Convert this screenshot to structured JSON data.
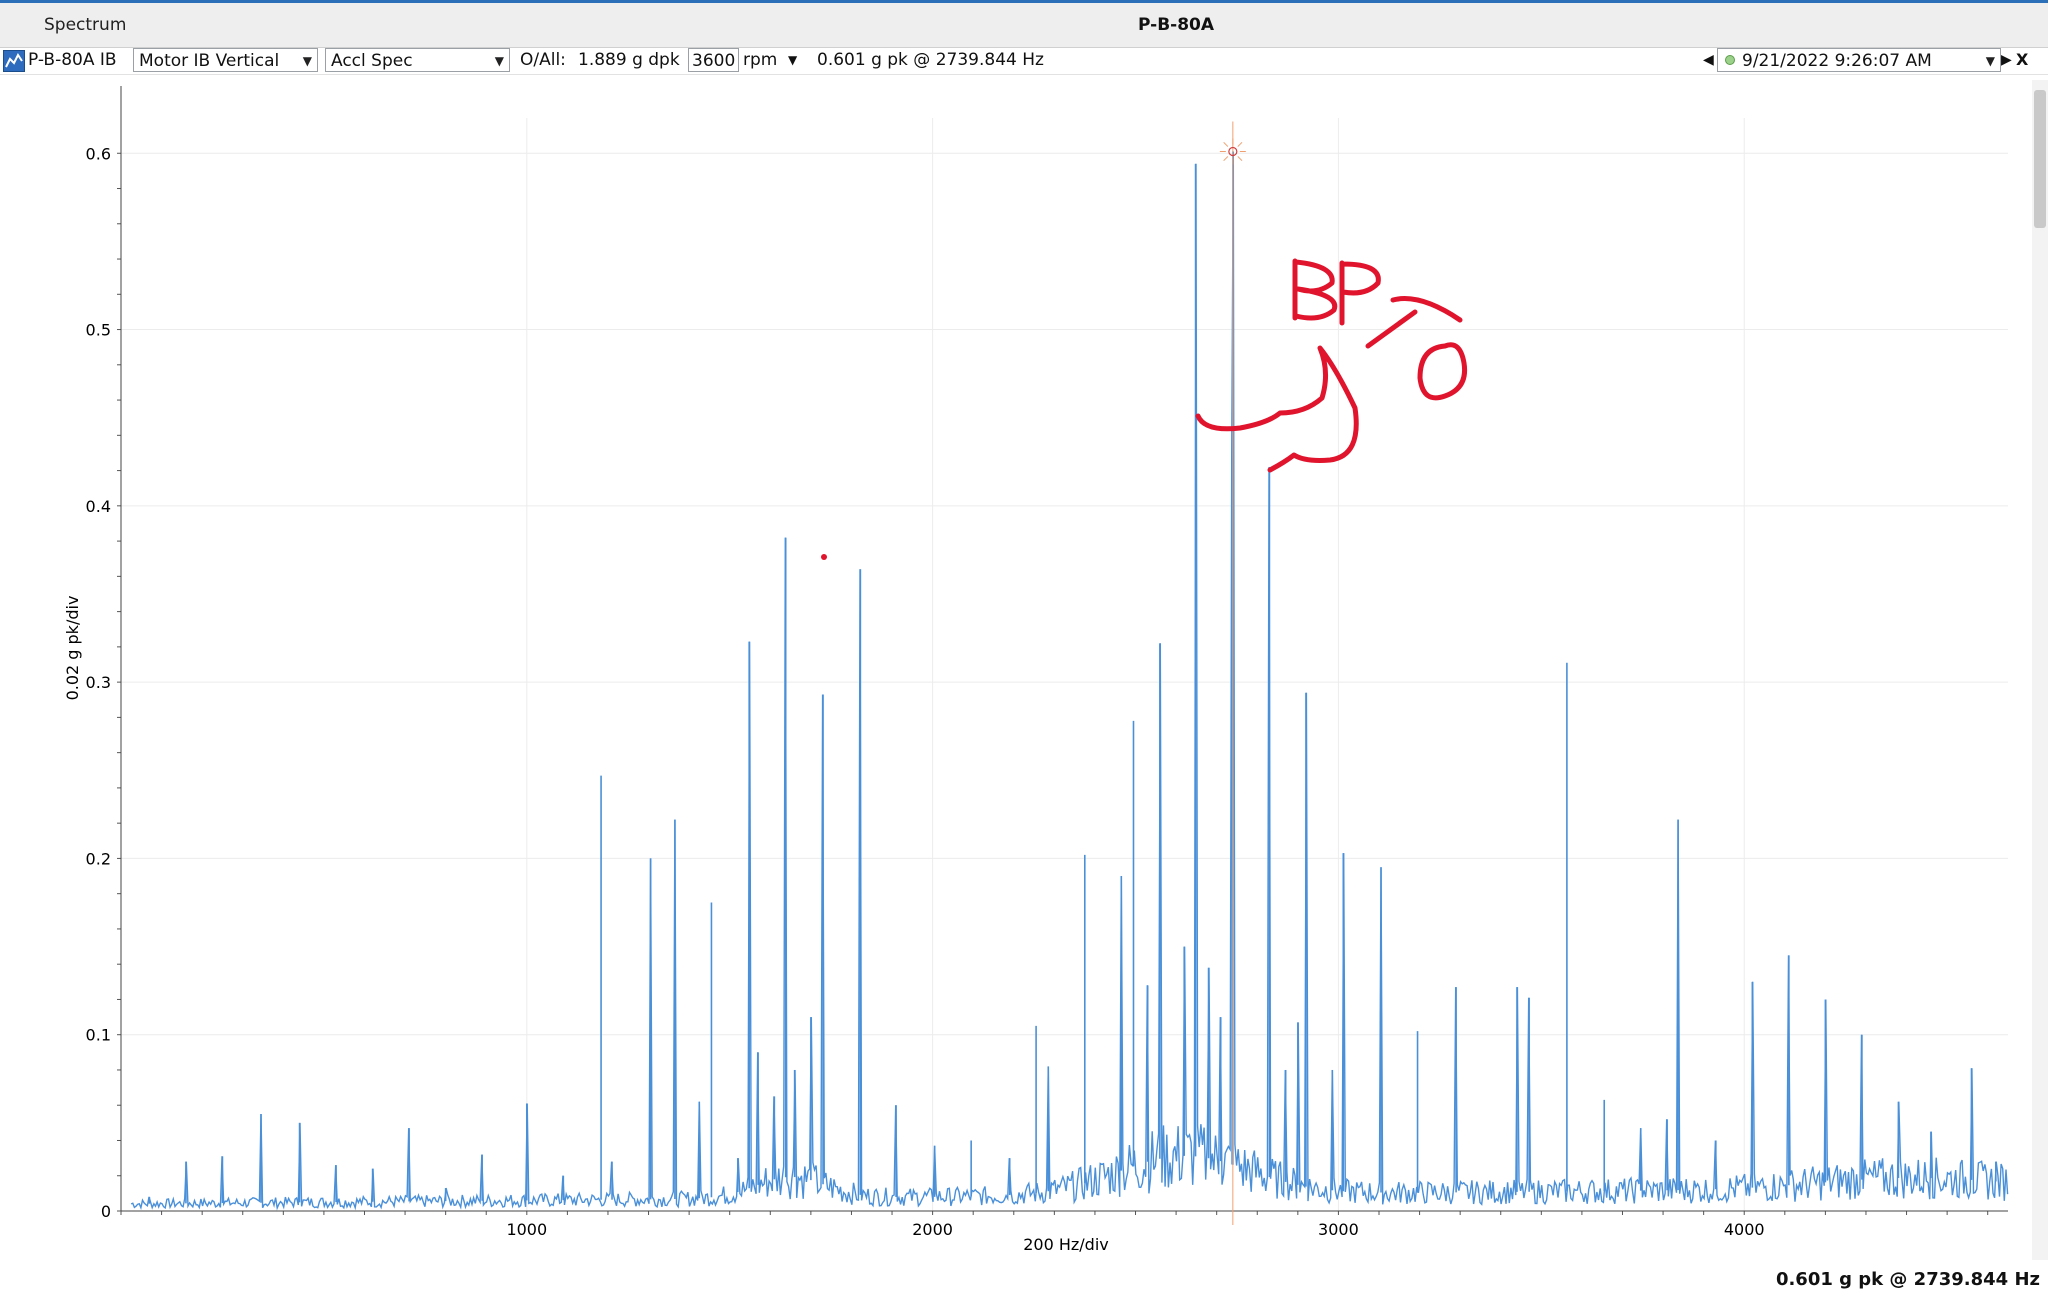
{
  "window": {
    "tab_label": "Spectrum",
    "title": "P-B-80A"
  },
  "toolbar": {
    "point_label": "P-B-80A IB",
    "measurement_select": "Motor IB Vertical",
    "spectrum_type_select": "Accl Spec",
    "overall_label": "O/All:",
    "overall_value": "1.889 g dpk",
    "rpm_value": "3600",
    "rpm_unit": "rpm",
    "cursor_readout": "0.601 g pk  @ 2739.844 Hz",
    "date_select": "9/21/2022 9:26:07 AM",
    "prev_icon": "triangle-left-icon",
    "next_icon": "triangle-right-icon",
    "close_label": "X",
    "status_color": "#9bd18a"
  },
  "annotation": {
    "text": "BPFO",
    "color": "#e0142c"
  },
  "footer": {
    "readout": "0.601 g pk @ 2739.844 Hz"
  },
  "chart_data": {
    "type": "line",
    "xlabel": "200 Hz/div",
    "ylabel": "0.02 g pk/div",
    "xlim": [
      0,
      4650
    ],
    "ylim": [
      0,
      0.62
    ],
    "xticks": [
      1000,
      2000,
      3000,
      4000
    ],
    "yticks": [
      0,
      0.1,
      0.2,
      0.3,
      0.4,
      0.5,
      0.6
    ],
    "grid": true,
    "line_color": "#4a90d9",
    "cursor": {
      "x": 2739.844,
      "y": 0.601
    },
    "peaks": [
      {
        "x": 70,
        "y": 0.008
      },
      {
        "x": 160,
        "y": 0.028
      },
      {
        "x": 250,
        "y": 0.031
      },
      {
        "x": 345,
        "y": 0.055
      },
      {
        "x": 440,
        "y": 0.05
      },
      {
        "x": 530,
        "y": 0.026
      },
      {
        "x": 620,
        "y": 0.024
      },
      {
        "x": 710,
        "y": 0.047
      },
      {
        "x": 800,
        "y": 0.013
      },
      {
        "x": 890,
        "y": 0.032
      },
      {
        "x": 1000,
        "y": 0.061
      },
      {
        "x": 1090,
        "y": 0.02
      },
      {
        "x": 1183,
        "y": 0.247
      },
      {
        "x": 1210,
        "y": 0.028
      },
      {
        "x": 1305,
        "y": 0.2
      },
      {
        "x": 1365,
        "y": 0.222
      },
      {
        "x": 1425,
        "y": 0.062
      },
      {
        "x": 1455,
        "y": 0.175
      },
      {
        "x": 1520,
        "y": 0.03
      },
      {
        "x": 1548,
        "y": 0.323
      },
      {
        "x": 1570,
        "y": 0.09
      },
      {
        "x": 1610,
        "y": 0.065
      },
      {
        "x": 1638,
        "y": 0.382
      },
      {
        "x": 1660,
        "y": 0.08
      },
      {
        "x": 1700,
        "y": 0.11
      },
      {
        "x": 1730,
        "y": 0.293
      },
      {
        "x": 1822,
        "y": 0.364
      },
      {
        "x": 1910,
        "y": 0.06
      },
      {
        "x": 2005,
        "y": 0.037
      },
      {
        "x": 2095,
        "y": 0.04
      },
      {
        "x": 2190,
        "y": 0.03
      },
      {
        "x": 2255,
        "y": 0.105
      },
      {
        "x": 2285,
        "y": 0.082
      },
      {
        "x": 2375,
        "y": 0.202
      },
      {
        "x": 2465,
        "y": 0.19
      },
      {
        "x": 2495,
        "y": 0.278
      },
      {
        "x": 2530,
        "y": 0.128
      },
      {
        "x": 2560,
        "y": 0.322
      },
      {
        "x": 2620,
        "y": 0.15
      },
      {
        "x": 2648,
        "y": 0.594
      },
      {
        "x": 2680,
        "y": 0.138
      },
      {
        "x": 2710,
        "y": 0.11
      },
      {
        "x": 2738,
        "y": 0.428
      },
      {
        "x": 2740,
        "y": 0.601
      },
      {
        "x": 2830,
        "y": 0.422
      },
      {
        "x": 2870,
        "y": 0.08
      },
      {
        "x": 2900,
        "y": 0.107
      },
      {
        "x": 2920,
        "y": 0.294
      },
      {
        "x": 2985,
        "y": 0.08
      },
      {
        "x": 3012,
        "y": 0.203
      },
      {
        "x": 3105,
        "y": 0.195
      },
      {
        "x": 3195,
        "y": 0.102
      },
      {
        "x": 3290,
        "y": 0.127
      },
      {
        "x": 3440,
        "y": 0.127
      },
      {
        "x": 3470,
        "y": 0.121
      },
      {
        "x": 3563,
        "y": 0.311
      },
      {
        "x": 3655,
        "y": 0.063
      },
      {
        "x": 3745,
        "y": 0.047
      },
      {
        "x": 3810,
        "y": 0.052
      },
      {
        "x": 3837,
        "y": 0.222
      },
      {
        "x": 3930,
        "y": 0.04
      },
      {
        "x": 4020,
        "y": 0.13
      },
      {
        "x": 4110,
        "y": 0.145
      },
      {
        "x": 4200,
        "y": 0.12
      },
      {
        "x": 4290,
        "y": 0.1
      },
      {
        "x": 4380,
        "y": 0.062
      },
      {
        "x": 4460,
        "y": 0.045
      },
      {
        "x": 4560,
        "y": 0.081
      },
      {
        "x": 4620,
        "y": 0.028
      }
    ]
  }
}
